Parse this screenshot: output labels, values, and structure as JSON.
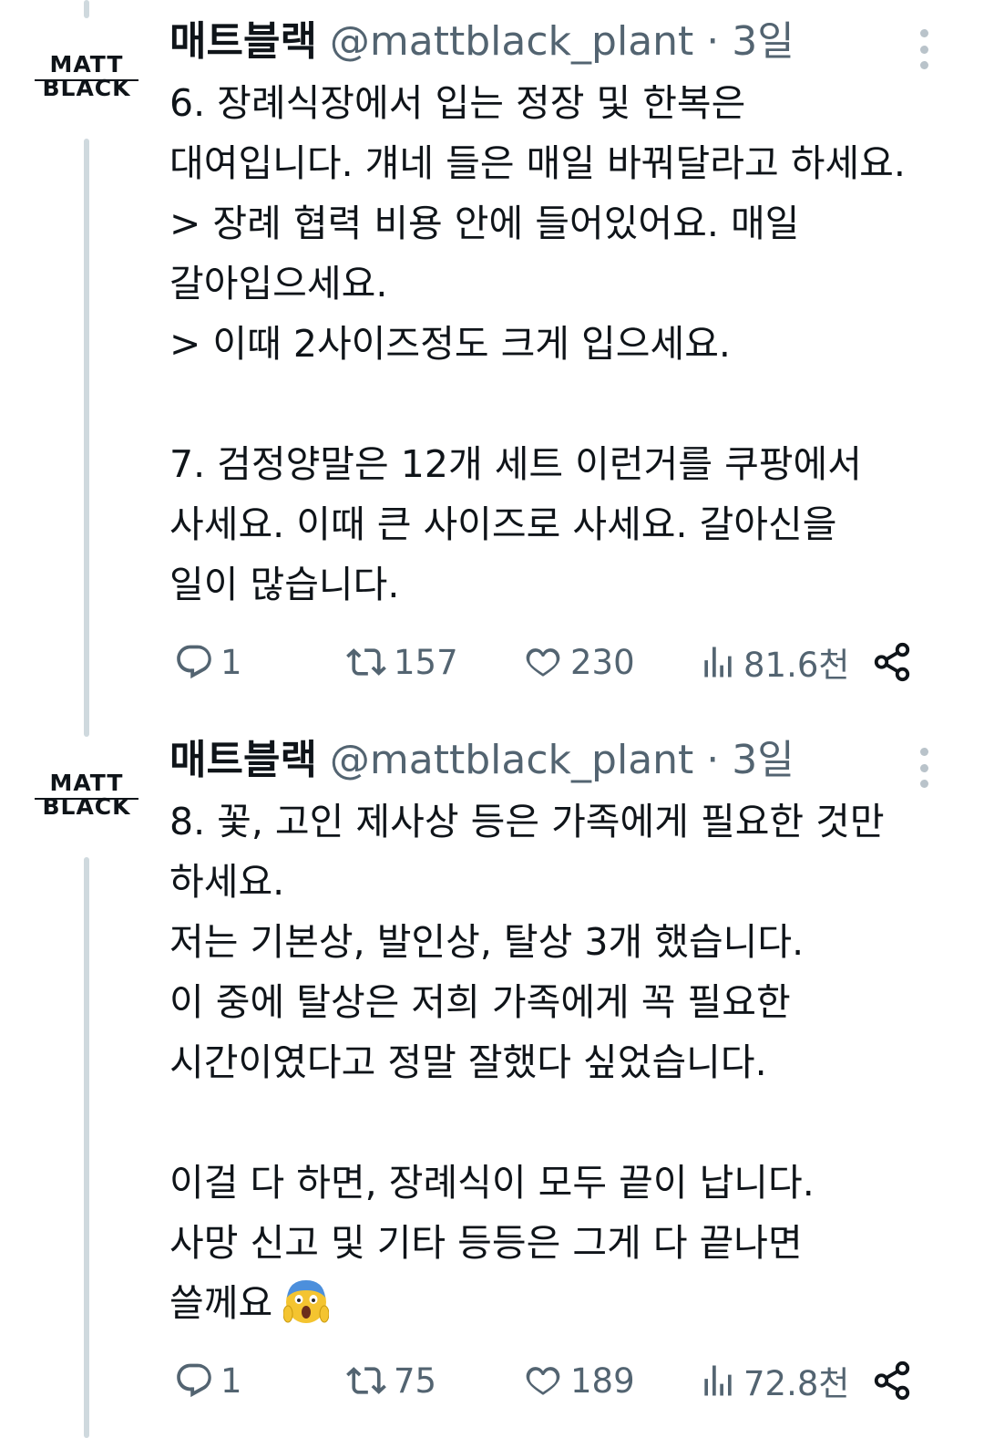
{
  "tweets": [
    {
      "avatar": {
        "line1": "MATT",
        "line2": "BLACK"
      },
      "display_name": "매트블랙",
      "handle": "@mattblack_plant",
      "separator": "·",
      "time": "3일",
      "lines": [
        "6. 장례식장에서 입는 정장 및 한복은",
        "대여입니다. 걔네 들은 매일 바꿔달라고 하세요.",
        "> 장례 협력 비용 안에 들어있어요. 매일",
        "갈아입으세요.",
        "> 이때 2사이즈정도 크게 입으세요.",
        "",
        "7. 검정양말은 12개 세트 이런거를 쿠팡에서",
        "사세요. 이때 큰 사이즈로 사세요. 갈아신을",
        "일이 많습니다."
      ],
      "replies": "1",
      "retweets": "157",
      "likes": "230",
      "views": "81.6천"
    },
    {
      "avatar": {
        "line1": "MATT",
        "line2": "BLACK"
      },
      "display_name": "매트블랙",
      "handle": "@mattblack_plant",
      "separator": "·",
      "time": "3일",
      "lines": [
        "8. 꽃, 고인 제사상 등은 가족에게 필요한 것만",
        "하세요.",
        "저는 기본상, 발인상, 탈상 3개 했습니다.",
        "이 중에 탈상은 저희 가족에게 꼭 필요한",
        "시간이였다고 정말 잘했다 싶었습니다.",
        "",
        "이걸 다 하면, 장례식이 모두 끝이 납니다.",
        "사망 신고 및 기타 등등은 그게 다 끝나면",
        "쓸께요"
      ],
      "emoji": "screaming-face-emoji",
      "replies": "1",
      "retweets": "75",
      "likes": "189",
      "views": "72.8천"
    }
  ],
  "colors": {
    "text": "#0f1419",
    "secondary": "#536471",
    "thread_line": "#cfd9de"
  }
}
